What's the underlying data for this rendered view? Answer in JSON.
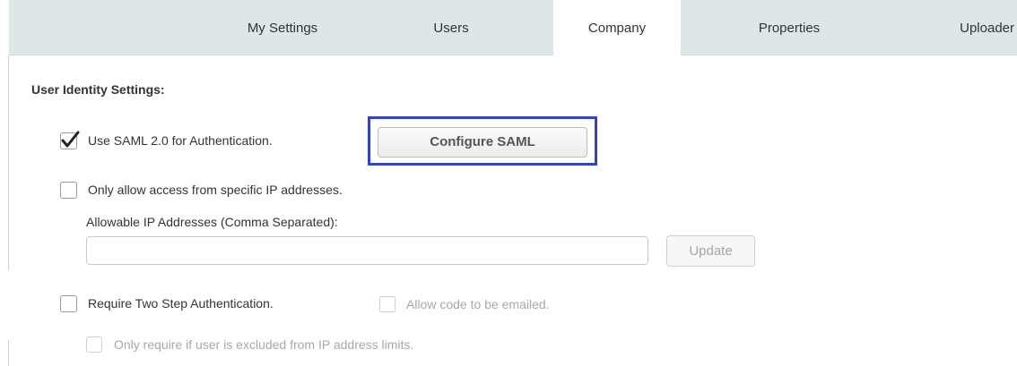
{
  "tabs": {
    "my_settings": "My Settings",
    "users": "Users",
    "company": "Company",
    "properties": "Properties",
    "uploader": "Uploader",
    "active": "Company"
  },
  "section_title": "User Identity Settings:",
  "saml": {
    "checked": true,
    "label": "Use SAML 2.0 for Authentication.",
    "configure_button": "Configure SAML"
  },
  "ip_restriction": {
    "checked": false,
    "label": "Only allow access from specific IP addresses.",
    "field_label": "Allowable IP Addresses (Comma Separated):",
    "field_value": "",
    "update_button": "Update"
  },
  "two_step": {
    "checked": false,
    "label": "Require Two Step Authentication.",
    "email_option_label": "Allow code to be emailed.",
    "email_option_checked": false,
    "excluded_option_label": "Only require if user is excluded from IP address limits.",
    "excluded_option_checked": false
  },
  "colors": {
    "highlight": "#3347b4",
    "tabbar_bg": "#dfe6e8"
  }
}
